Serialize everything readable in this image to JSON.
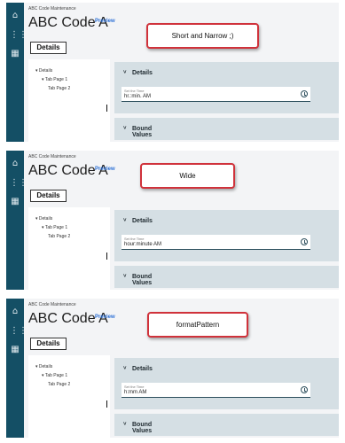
{
  "panels": [
    {
      "breadcrumb": "ABC Code Maintenance",
      "title": "ABC Code A",
      "preview_label": "Preview",
      "details_button": "Details",
      "tree": [
        "Details",
        "Tab Page 1",
        "Tab Page 2"
      ],
      "details_section": "Details",
      "field_label": "Set the Time",
      "field_value": "hr.:min. AM",
      "bound_section": "Bound Values",
      "callout": "Short and Narrow ;)"
    },
    {
      "breadcrumb": "ABC Code Maintenance",
      "title": "ABC Code A",
      "preview_label": "Preview",
      "details_button": "Details",
      "tree": [
        "Details",
        "Tab Page 1",
        "Tab Page 2"
      ],
      "details_section": "Details",
      "field_label": "Set the Time",
      "field_value": "hour:minute AM",
      "bound_section": "Bound Values",
      "callout": "Wide"
    },
    {
      "breadcrumb": "ABC Code Maintenance",
      "title": "ABC Code A",
      "preview_label": "Preview",
      "details_button": "Details",
      "tree": [
        "Details",
        "Tab Page 1",
        "Tab Page 2"
      ],
      "details_section": "Details",
      "field_label": "Set the Time",
      "field_value": "h:mm AM",
      "bound_section": "Bound Values",
      "callout": "formatPattern"
    }
  ],
  "icons": {
    "rail": [
      "home-icon",
      "apps-grid-icon",
      "dashboard-icon"
    ],
    "tree_expand": "▾",
    "tree_branch": "▾",
    "section_chevron": "˅",
    "field": "clock-icon"
  },
  "colors": {
    "rail": "#144f65",
    "section": "#d5dfe4",
    "preview_link": "#2b6fd6",
    "callout_border": "#d0323b"
  }
}
